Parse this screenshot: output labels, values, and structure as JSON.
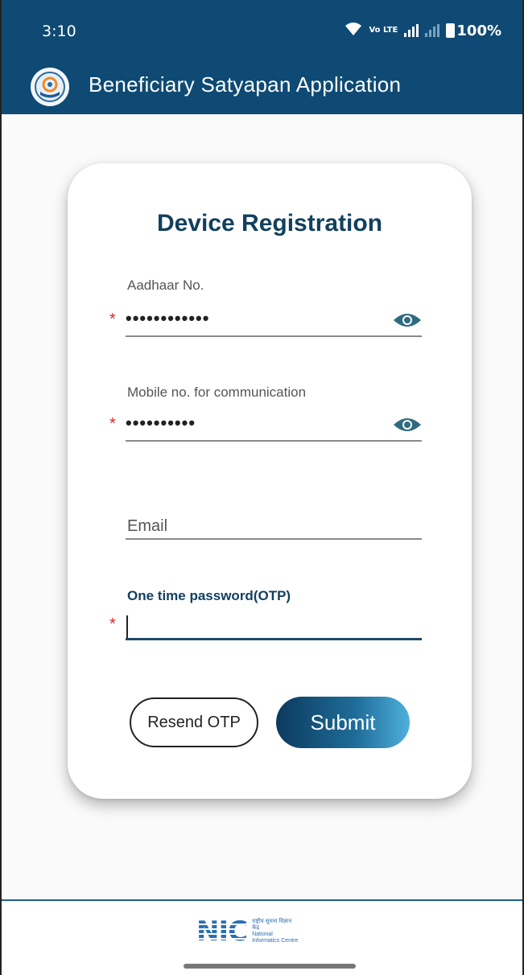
{
  "status_bar": {
    "time": "3:10",
    "network_label": "Vo LTE",
    "battery": "100%"
  },
  "app_bar": {
    "title": "Beneficiary Satyapan Application"
  },
  "form": {
    "title": "Device Registration",
    "aadhaar": {
      "label": "Aadhaar No.",
      "value": "••••••••••••"
    },
    "mobile": {
      "label": "Mobile no. for communication",
      "value": "••••••••••"
    },
    "email": {
      "placeholder": "Email"
    },
    "otp": {
      "label": "One time password(OTP)"
    },
    "required_marker": "*",
    "resend_label": "Resend OTP",
    "submit_label": "Submit"
  },
  "footer": {
    "logo_mark": "NIC",
    "logo_hindi": "राष्ट्रीय सूचना विज्ञान केंद्र",
    "logo_text": "National Informatics Centre"
  },
  "colors": {
    "primary": "#0e4a73",
    "title": "#12405e",
    "required": "#d62b2b",
    "eye_icon": "#2e6b80"
  }
}
